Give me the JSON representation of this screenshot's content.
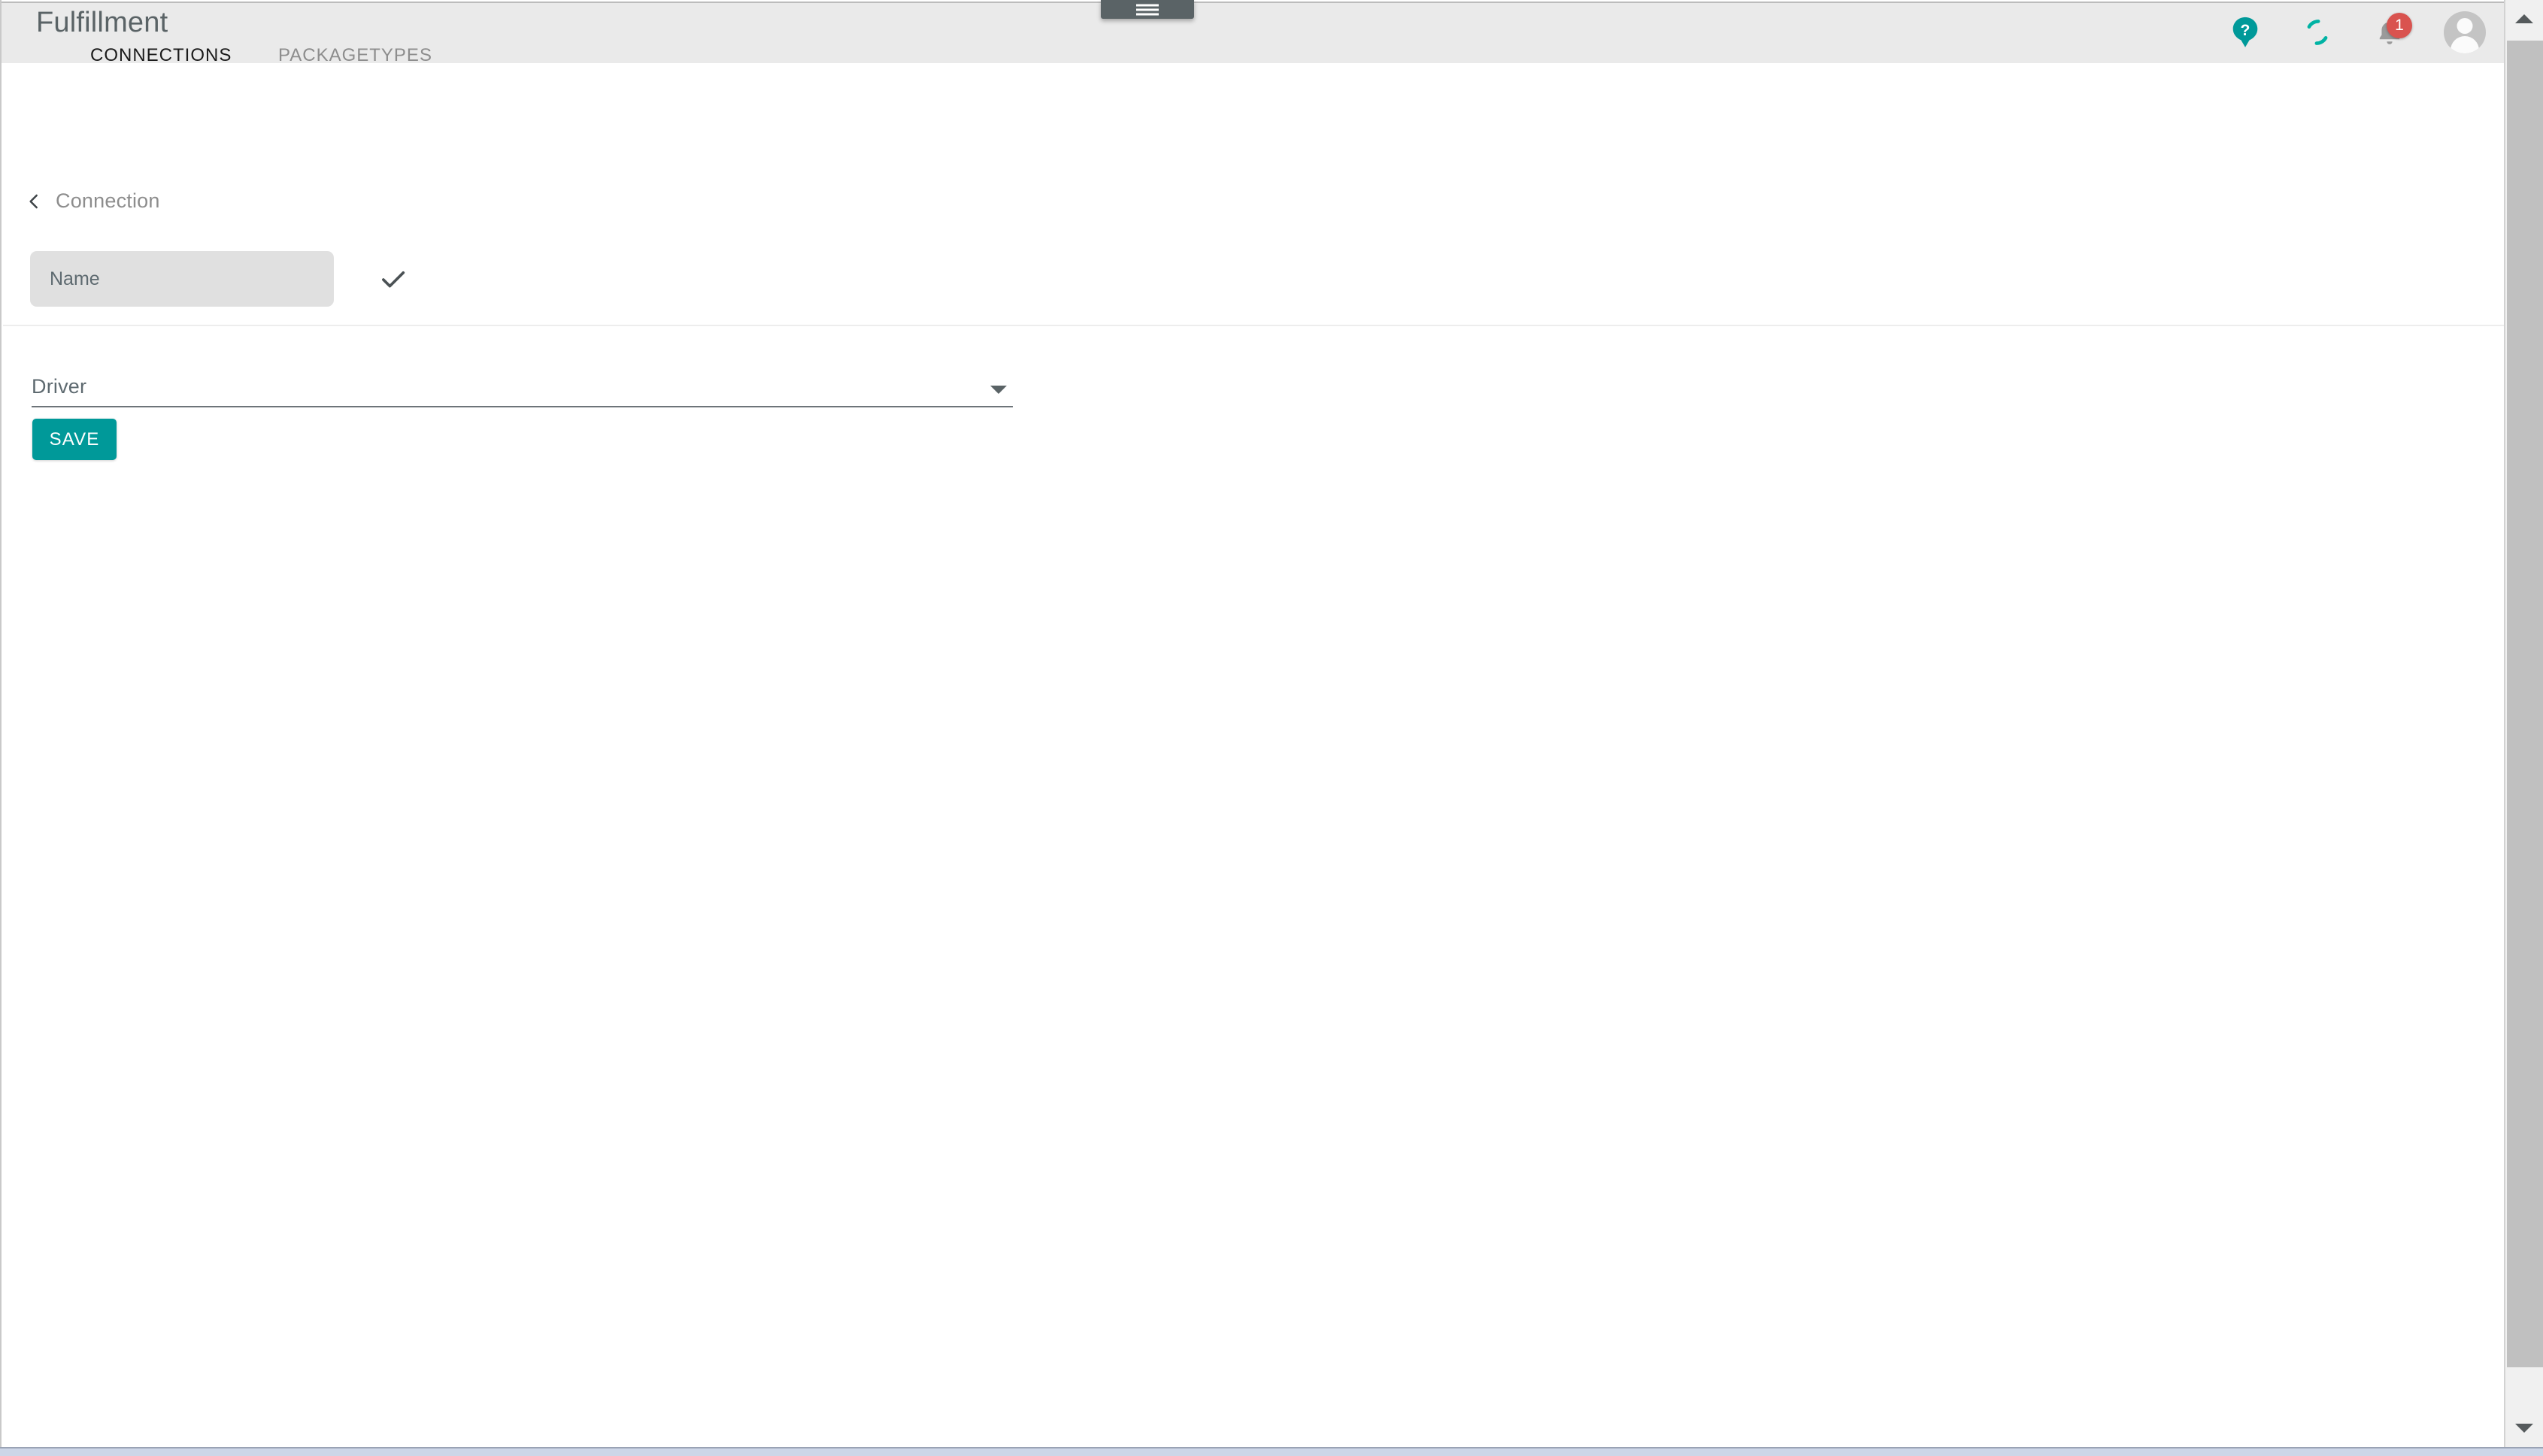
{
  "app": {
    "title": "Fulfillment"
  },
  "header": {
    "drawer_handle_icon": "hamburger-menu-icon",
    "icons": [
      {
        "name": "help-icon",
        "label": "Help"
      },
      {
        "name": "sync-spinner-icon",
        "label": "Loading"
      },
      {
        "name": "notifications-bell-icon",
        "label": "Notifications",
        "badge": "1"
      },
      {
        "name": "user-avatar-icon",
        "label": "Account"
      }
    ],
    "notification_count": "1"
  },
  "tabs": [
    {
      "label": "CONNECTIONS",
      "active": true
    },
    {
      "label": "PACKAGETYPES",
      "active": false
    }
  ],
  "breadcrumb": {
    "back_icon": "chevron-left-icon",
    "label": "Connection"
  },
  "form": {
    "name_field": {
      "label": "Name",
      "placeholder": "Name",
      "value": ""
    },
    "confirm_icon": "checkmark-icon",
    "driver_select": {
      "label": "Driver",
      "value": "",
      "caret_icon": "triangle-down-icon",
      "options": []
    },
    "save_button": {
      "label": "SAVE"
    }
  },
  "scrollbar": {
    "up_icon": "triangle-up-icon",
    "down_icon": "triangle-down-icon"
  },
  "colors": {
    "accent_teal": "#009999",
    "header_bg": "#eaeaea",
    "slate": "#5a6366",
    "badge_red": "#d9534f",
    "field_bg": "#e0e0e0",
    "muted_text": "#8d8d8d"
  }
}
